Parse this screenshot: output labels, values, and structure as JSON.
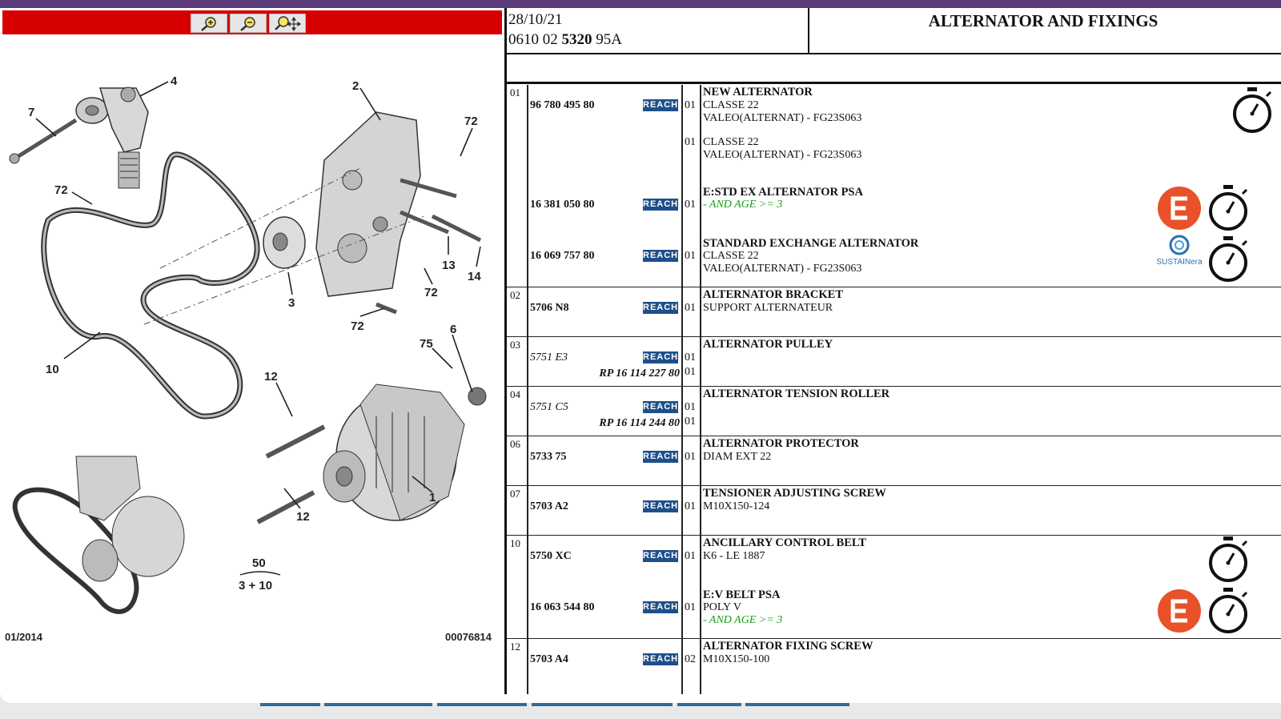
{
  "toolbar": {
    "zoom_in": "zoom-in",
    "zoom_out": "zoom-out",
    "pan": "pan"
  },
  "diagram": {
    "labels": {
      "l1": "1",
      "l2": "2",
      "l3": "3",
      "l4": "4",
      "l6": "6",
      "l7": "7",
      "l10": "10",
      "l12a": "12",
      "l12b": "12",
      "l13": "13",
      "l14": "14",
      "l72a": "72",
      "l72b": "72",
      "l72c": "72",
      "l72d": "72",
      "l75": "75",
      "l50": "50",
      "l310": "3 + 10"
    },
    "date": "01/2014",
    "code": "00076814"
  },
  "header": {
    "date": "28/10/21",
    "ref_prefix": "0610 02 ",
    "ref_bold": "5320",
    "ref_suffix": " 95A",
    "title": "ALTERNATOR AND FIXINGS"
  },
  "reach_label": "REACH",
  "rows": [
    {
      "line": "01",
      "part": "96 780 495 80",
      "qty": "01",
      "d1": "NEW ALTERNATOR",
      "d2": "CLASSE 22",
      "d3": "VALEO(ALTERNAT) - FG23S063"
    },
    {
      "qty": "01",
      "d2": "CLASSE 22",
      "d3": "VALEO(ALTERNAT) - FG23S063"
    },
    {
      "part": "16 381 050 80",
      "qty": "01",
      "d1": "E:STD EX ALTERNATOR PSA",
      "cond": "- AND AGE >= 3"
    },
    {
      "part": "16 069 757 80",
      "qty": "01",
      "d1": "STANDARD EXCHANGE ALTERNATOR",
      "d2": "CLASSE 22",
      "d3": "VALEO(ALTERNAT) - FG23S063",
      "logo": "SUSTAINera"
    },
    {
      "line": "02",
      "part": "5706 N8",
      "qty": "01",
      "d1": "ALTERNATOR BRACKET",
      "d2": "SUPPORT ALTERNATEUR"
    },
    {
      "line": "03",
      "part": "5751 E3",
      "rp": "RP 16 114 227 80",
      "qty": "01",
      "qty2": "01",
      "d1": "ALTERNATOR PULLEY"
    },
    {
      "line": "04",
      "part": "5751 C5",
      "rp": "RP 16 114 244 80",
      "qty": "01",
      "qty2": "01",
      "d1": "ALTERNATOR TENSION ROLLER"
    },
    {
      "line": "06",
      "part": "5733 75",
      "qty": "01",
      "d1": "ALTERNATOR PROTECTOR",
      "d2": "DIAM EXT 22"
    },
    {
      "line": "07",
      "part": "5703 A2",
      "qty": "01",
      "d1": "TENSIONER ADJUSTING SCREW",
      "d2": "M10X150-124"
    },
    {
      "line": "10",
      "part": "5750 XC",
      "qty": "01",
      "d1": "ANCILLARY CONTROL BELT",
      "d2": "K6 - LE 1887"
    },
    {
      "part": "16 063 544 80",
      "qty": "01",
      "d1": "E:V BELT PSA",
      "d2": "POLY V",
      "cond": "- AND AGE >= 3"
    },
    {
      "line": "12",
      "part": "5703 A4",
      "qty": "02",
      "d1": "ALTERNATOR FIXING SCREW",
      "d2": "M10X150-100"
    }
  ],
  "colors": {
    "red_bar": "#d70000",
    "reach": "#1f4f8a",
    "exchange_logo": "#e8512a",
    "condition": "#17a317"
  }
}
